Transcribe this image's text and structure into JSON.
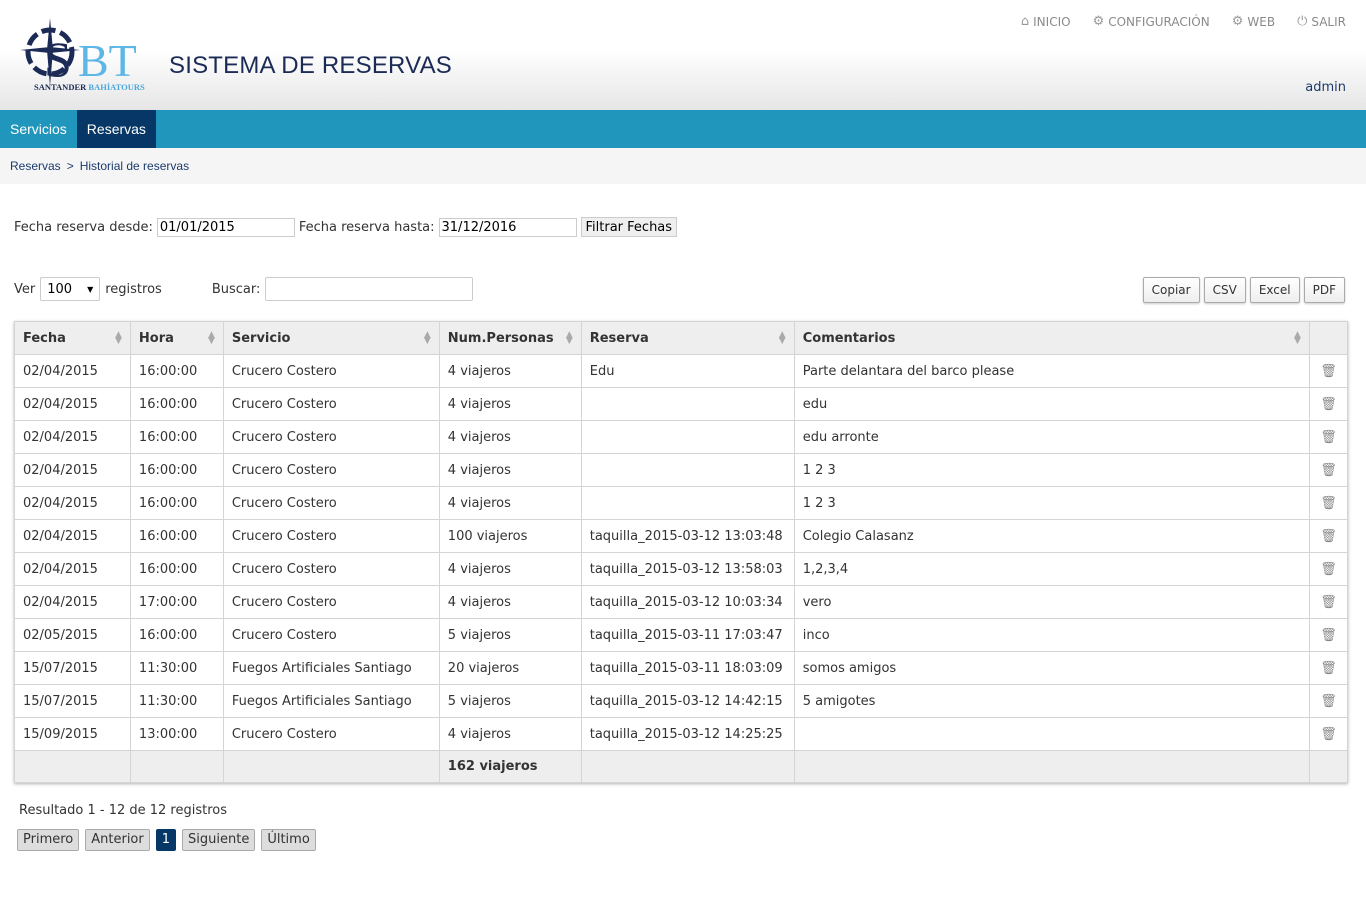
{
  "header": {
    "logo_text": "SBT",
    "logo_subtitle": "SANTANDER BAHÍATOURS",
    "title": "SISTEMA DE RESERVAS",
    "user": "admin",
    "topnav": [
      {
        "label": "INICIO",
        "icon": "home-icon"
      },
      {
        "label": "CONFIGURACIÓN",
        "icon": "gear-icon"
      },
      {
        "label": "WEB",
        "icon": "gear-icon"
      },
      {
        "label": "SALIR",
        "icon": "power-icon"
      }
    ]
  },
  "menu": [
    {
      "label": "Servicios",
      "active": false
    },
    {
      "label": "Reservas",
      "active": true
    }
  ],
  "breadcrumb": {
    "items": [
      "Reservas",
      "Historial de reservas"
    ],
    "separator": ">"
  },
  "filters": {
    "from_label": "Fecha reserva desde:",
    "from_value": "01/01/2015",
    "to_label": "Fecha reserva hasta:",
    "to_value": "31/12/2016",
    "button": "Filtrar Fechas"
  },
  "controls": {
    "show_label": "Ver",
    "show_value": "100",
    "records_label": "registros",
    "search_label": "Buscar:",
    "search_value": ""
  },
  "exports": [
    "Copiar",
    "CSV",
    "Excel",
    "PDF"
  ],
  "table": {
    "columns": [
      "Fecha",
      "Hora",
      "Servicio",
      "Num.Personas",
      "Reserva",
      "Comentarios"
    ],
    "rows": [
      [
        "02/04/2015",
        "16:00:00",
        "Crucero Costero",
        "4 viajeros",
        "Edu",
        "Parte delantara del barco please"
      ],
      [
        "02/04/2015",
        "16:00:00",
        "Crucero Costero",
        "4 viajeros",
        "",
        "edu"
      ],
      [
        "02/04/2015",
        "16:00:00",
        "Crucero Costero",
        "4 viajeros",
        "",
        "edu arronte"
      ],
      [
        "02/04/2015",
        "16:00:00",
        "Crucero Costero",
        "4 viajeros",
        "",
        "1 2 3"
      ],
      [
        "02/04/2015",
        "16:00:00",
        "Crucero Costero",
        "4 viajeros",
        "",
        "1 2 3"
      ],
      [
        "02/04/2015",
        "16:00:00",
        "Crucero Costero",
        "100 viajeros",
        "taquilla_2015-03-12 13:03:48",
        "Colegio Calasanz"
      ],
      [
        "02/04/2015",
        "16:00:00",
        "Crucero Costero",
        "4 viajeros",
        "taquilla_2015-03-12 13:58:03",
        "1,2,3,4"
      ],
      [
        "02/04/2015",
        "17:00:00",
        "Crucero Costero",
        "4 viajeros",
        "taquilla_2015-03-12 10:03:34",
        "vero"
      ],
      [
        "02/05/2015",
        "16:00:00",
        "Crucero Costero",
        "5 viajeros",
        "taquilla_2015-03-11 17:03:47",
        "inco"
      ],
      [
        "15/07/2015",
        "11:30:00",
        "Fuegos Artificiales Santiago",
        "20 viajeros",
        "taquilla_2015-03-11 18:03:09",
        "somos amigos"
      ],
      [
        "15/07/2015",
        "11:30:00",
        "Fuegos Artificiales Santiago",
        "5 viajeros",
        "taquilla_2015-03-12 14:42:15",
        "5 amigotes"
      ],
      [
        "15/09/2015",
        "13:00:00",
        "Crucero Costero",
        "4 viajeros",
        "taquilla_2015-03-12 14:25:25",
        ""
      ]
    ],
    "total": "162 viajeros"
  },
  "result_text": "Resultado 1 - 12 de 12 registros",
  "pager": {
    "first": "Primero",
    "prev": "Anterior",
    "current": "1",
    "next": "Siguiente",
    "last": "Último"
  },
  "colors": {
    "menu": "#2196bc",
    "active": "#063766"
  }
}
